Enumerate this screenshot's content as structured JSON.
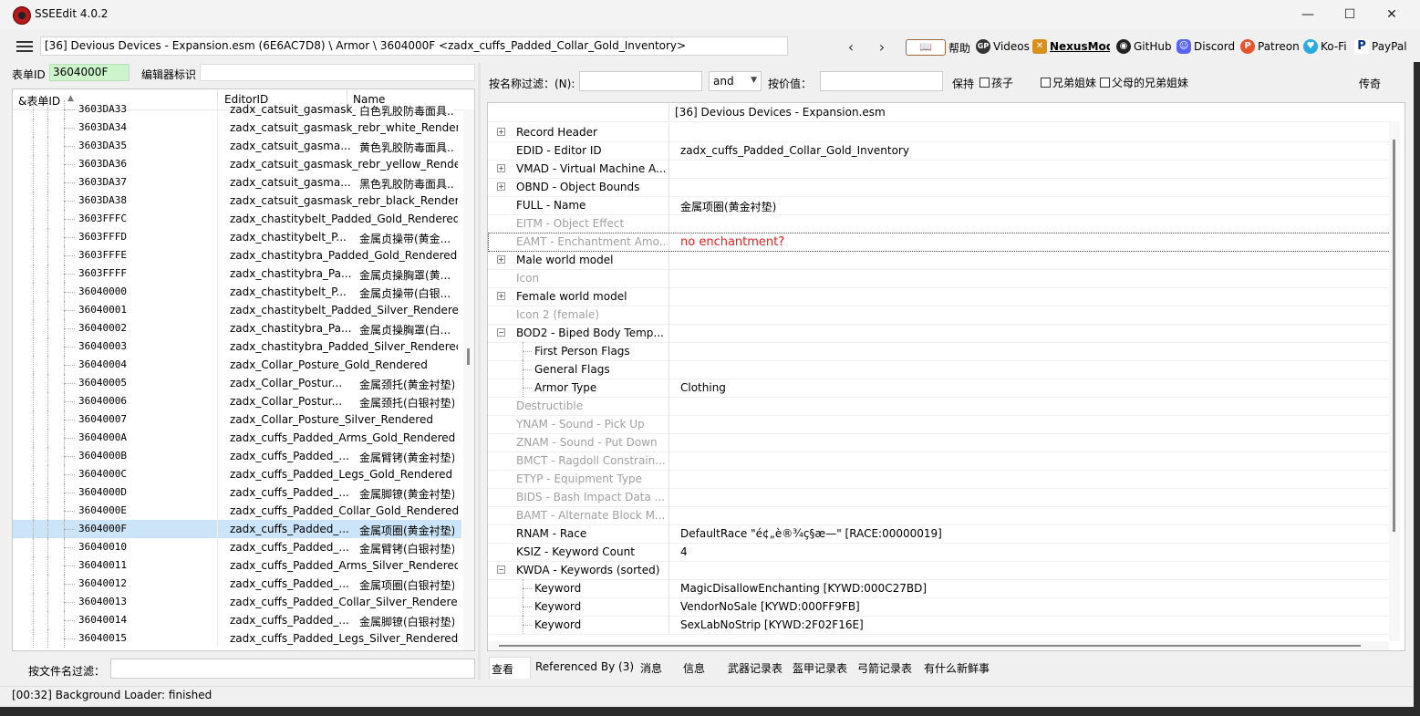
{
  "window": {
    "title": "SSEEdit 4.0.2",
    "minimize": "—",
    "maximize": "☐",
    "close": "✕"
  },
  "toolbar": {
    "path": "[36] Devious Devices - Expansion.esm (6E6AC7D8) \\ Armor \\ 3604000F <zadx_cuffs_Padded_Collar_Gold_Inventory>",
    "back": "‹",
    "forward": "›",
    "links": [
      {
        "label": "帮助",
        "icon": "book-icon"
      },
      {
        "label": "Videos",
        "icon": "gp-icon"
      },
      {
        "label": "NexusMods",
        "icon": "nexus-icon"
      },
      {
        "label": "GitHub",
        "icon": "github-icon"
      },
      {
        "label": "Discord",
        "icon": "discord-icon"
      },
      {
        "label": "Patreon",
        "icon": "patreon-icon"
      },
      {
        "label": "Ko-Fi",
        "icon": "kofi-icon"
      },
      {
        "label": "PayPal",
        "icon": "paypal-icon"
      }
    ]
  },
  "left": {
    "formid_label": "表单ID",
    "formid_value": "3604000F",
    "editorid_label": "编辑器标识",
    "columns": [
      "&表单ID",
      "EditorID",
      "Name"
    ],
    "rows": [
      {
        "id": "3603DA33",
        "editor": "zadx_catsuit_gasmask_rebr_...",
        "name": "白色乳胶防毒面具..."
      },
      {
        "id": "3603DA34",
        "editor": "zadx_catsuit_gasmask_rebr_white_Render...",
        "name": ""
      },
      {
        "id": "3603DA35",
        "editor": "zadx_catsuit_gasma...",
        "name": "黄色乳胶防毒面具..."
      },
      {
        "id": "3603DA36",
        "editor": "zadx_catsuit_gasmask_rebr_yellow_Rende...",
        "name": ""
      },
      {
        "id": "3603DA37",
        "editor": "zadx_catsuit_gasma...",
        "name": "黑色乳胶防毒面具..."
      },
      {
        "id": "3603DA38",
        "editor": "zadx_catsuit_gasmask_rebr_black_Render...",
        "name": ""
      },
      {
        "id": "3603FFFC",
        "editor": "zadx_chastitybelt_Padded_Gold_Rendered",
        "name": ""
      },
      {
        "id": "3603FFFD",
        "editor": "zadx_chastitybelt_P...",
        "name": "金属贞操带(黄金..."
      },
      {
        "id": "3603FFFE",
        "editor": "zadx_chastitybra_Padded_Gold_Rendered",
        "name": ""
      },
      {
        "id": "3603FFFF",
        "editor": "zadx_chastitybra_Pa...",
        "name": "金属贞操胸罩(黄..."
      },
      {
        "id": "36040000",
        "editor": "zadx_chastitybelt_P...",
        "name": "金属贞操带(白银..."
      },
      {
        "id": "36040001",
        "editor": "zadx_chastitybelt_Padded_Silver_Rendered",
        "name": ""
      },
      {
        "id": "36040002",
        "editor": "zadx_chastitybra_Pa...",
        "name": "金属贞操胸罩(白..."
      },
      {
        "id": "36040003",
        "editor": "zadx_chastitybra_Padded_Silver_Rendered",
        "name": ""
      },
      {
        "id": "36040004",
        "editor": "zadx_Collar_Posture_Gold_Rendered",
        "name": ""
      },
      {
        "id": "36040005",
        "editor": "zadx_Collar_Postur...",
        "name": "金属颈托(黄金衬垫)"
      },
      {
        "id": "36040006",
        "editor": "zadx_Collar_Postur...",
        "name": "金属颈托(白银衬垫)"
      },
      {
        "id": "36040007",
        "editor": "zadx_Collar_Posture_Silver_Rendered",
        "name": ""
      },
      {
        "id": "3604000A",
        "editor": "zadx_cuffs_Padded_Arms_Gold_Rendered",
        "name": ""
      },
      {
        "id": "3604000B",
        "editor": "zadx_cuffs_Padded_...",
        "name": "金属臂铐(黄金衬垫)"
      },
      {
        "id": "3604000C",
        "editor": "zadx_cuffs_Padded_Legs_Gold_Rendered",
        "name": ""
      },
      {
        "id": "3604000D",
        "editor": "zadx_cuffs_Padded_...",
        "name": "金属脚镣(黄金衬垫)"
      },
      {
        "id": "3604000E",
        "editor": "zadx_cuffs_Padded_Collar_Gold_Rendered",
        "name": ""
      },
      {
        "id": "3604000F",
        "editor": "zadx_cuffs_Padded_...",
        "name": "金属项圈(黄金衬垫)",
        "selected": true
      },
      {
        "id": "36040010",
        "editor": "zadx_cuffs_Padded_...",
        "name": "金属臂铐(白银衬垫)"
      },
      {
        "id": "36040011",
        "editor": "zadx_cuffs_Padded_Arms_Silver_Rendered",
        "name": ""
      },
      {
        "id": "36040012",
        "editor": "zadx_cuffs_Padded_...",
        "name": "金属项圈(白银衬垫)"
      },
      {
        "id": "36040013",
        "editor": "zadx_cuffs_Padded_Collar_Silver_Rendered",
        "name": ""
      },
      {
        "id": "36040014",
        "editor": "zadx_cuffs_Padded_...",
        "name": "金属脚镣(白银衬垫)"
      },
      {
        "id": "36040015",
        "editor": "zadx_cuffs_Padded_Legs_Silver_Rendered",
        "name": ""
      }
    ],
    "filefilter_label": "按文件名过滤："
  },
  "right": {
    "namefilter_label": "按名称过滤：(N):",
    "and_value": "and",
    "valuefilter_label": "按价值：",
    "keep_label": "保持",
    "checkboxes": [
      "孩子",
      "兄弟姐妹",
      "父母的兄弟姐妹"
    ],
    "legend_button": "传奇",
    "header_value": "[36] Devious Devices - Expansion.esm",
    "rows": [
      {
        "name": "Record Header",
        "value": "",
        "exp": "+",
        "dim": false
      },
      {
        "name": "EDID - Editor ID",
        "value": "zadx_cuffs_Padded_Collar_Gold_Inventory",
        "exp": "",
        "dim": false
      },
      {
        "name": "VMAD - Virtual Machine A...",
        "value": "",
        "exp": "+",
        "dim": false
      },
      {
        "name": "OBND - Object Bounds",
        "value": "",
        "exp": "+",
        "dim": false
      },
      {
        "name": "FULL - Name",
        "value": "金属项圈(黄金衬垫)",
        "exp": "",
        "dim": false
      },
      {
        "name": "EITM - Object Effect",
        "value": "",
        "exp": "",
        "dim": true
      },
      {
        "name": "EAMT - Enchantment Amo...",
        "value": "no enchantment?",
        "exp": "",
        "dim": true,
        "red": true,
        "focus": true
      },
      {
        "name": "Male world model",
        "value": "",
        "exp": "+",
        "dim": false
      },
      {
        "name": "Icon",
        "value": "",
        "exp": "",
        "dim": true
      },
      {
        "name": "Female world model",
        "value": "",
        "exp": "+",
        "dim": false
      },
      {
        "name": "Icon 2 (female)",
        "value": "",
        "exp": "",
        "dim": true
      },
      {
        "name": "BOD2 - Biped Body Temp...",
        "value": "",
        "exp": "−",
        "dim": false
      },
      {
        "name": "First Person Flags",
        "value": "",
        "exp": "",
        "dim": false,
        "sub": true
      },
      {
        "name": "General Flags",
        "value": "",
        "exp": "",
        "dim": false,
        "sub": true
      },
      {
        "name": "Armor Type",
        "value": "Clothing",
        "exp": "",
        "dim": false,
        "sub": true
      },
      {
        "name": "Destructible",
        "value": "",
        "exp": "",
        "dim": true
      },
      {
        "name": "YNAM - Sound - Pick Up",
        "value": "",
        "exp": "",
        "dim": true
      },
      {
        "name": "ZNAM - Sound - Put Down",
        "value": "",
        "exp": "",
        "dim": true
      },
      {
        "name": "BMCT - Ragdoll Constrain...",
        "value": "",
        "exp": "",
        "dim": true
      },
      {
        "name": "ETYP - Equipment Type",
        "value": "",
        "exp": "",
        "dim": true
      },
      {
        "name": "BIDS - Bash Impact Data ...",
        "value": "",
        "exp": "",
        "dim": true
      },
      {
        "name": "BAMT - Alternate Block M...",
        "value": "",
        "exp": "",
        "dim": true
      },
      {
        "name": "RNAM - Race",
        "value": "DefaultRace \"é¢„è®¾ç§æ—\" [RACE:00000019]",
        "exp": "",
        "dim": false
      },
      {
        "name": "KSIZ - Keyword Count",
        "value": "4",
        "exp": "",
        "dim": false
      },
      {
        "name": "KWDA - Keywords (sorted)",
        "value": "",
        "exp": "−",
        "dim": false
      },
      {
        "name": "Keyword",
        "value": "MagicDisallowEnchanting [KYWD:000C27BD]",
        "exp": "",
        "dim": false,
        "sub": true
      },
      {
        "name": "Keyword",
        "value": "VendorNoSale [KYWD:000FF9FB]",
        "exp": "",
        "dim": false,
        "sub": true
      },
      {
        "name": "Keyword",
        "value": "SexLabNoStrip [KYWD:2F02F16E]",
        "exp": "",
        "dim": false,
        "sub": true
      }
    ],
    "tabs": [
      "查看",
      "Referenced By (3)",
      "消息",
      "信息",
      "武器记录表",
      "盔甲记录表",
      "弓箭记录表",
      "有什么新鲜事"
    ]
  },
  "status": "[00:32] Background Loader: finished"
}
